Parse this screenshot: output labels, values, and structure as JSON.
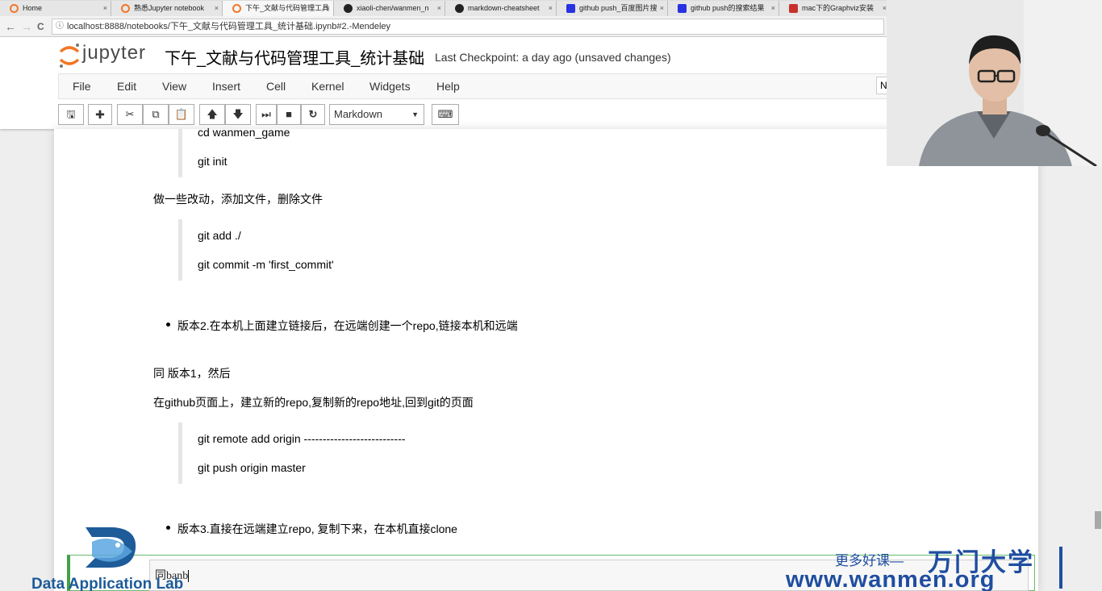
{
  "browser": {
    "tabs": [
      {
        "title": "Home",
        "icon": "jupyter-icon",
        "color": "#f37626"
      },
      {
        "title": "熟悉Jupyter notebook",
        "icon": "jupyter-icon",
        "color": "#f37626"
      },
      {
        "title": "下午_文献与代码管理工具",
        "icon": "jupyter-icon",
        "color": "#f37626",
        "active": true
      },
      {
        "title": "xiaoli-chen/wanmen_n",
        "icon": "github-icon",
        "color": "#222222"
      },
      {
        "title": "markdown-cheatsheet",
        "icon": "github-icon",
        "color": "#222222"
      },
      {
        "title": "github push_百度图片搜",
        "icon": "baidu-icon",
        "color": "#2932e1"
      },
      {
        "title": "github push的搜索结果",
        "icon": "baidu-icon",
        "color": "#2932e1"
      },
      {
        "title": "mac下的Graphviz安装",
        "icon": "csdn-icon",
        "color": "#c9302c"
      }
    ],
    "tab_close": "×",
    "url": "localhost:8888/notebooks/下午_文献与代码管理工具_统计基础.ipynb#2.-Mendeley",
    "back": "←",
    "forward": "→",
    "reload": "C",
    "info": "ⓘ"
  },
  "jupyter": {
    "logo_text": "jupyter",
    "notebook_title": "下午_文献与代码管理工具_统计基础",
    "checkpoint": "Last Checkpoint: a day ago (unsaved changes)",
    "kernel_indicator": "N",
    "menu": [
      "File",
      "Edit",
      "View",
      "Insert",
      "Cell",
      "Kernel",
      "Widgets",
      "Help"
    ],
    "toolbar": {
      "save": "🖫",
      "add": "✚",
      "cut": "✂",
      "copy": "⧉",
      "paste": "📋",
      "up": "🡅",
      "down": "🡇",
      "run": "⏭",
      "stop": "■",
      "restart": "↻",
      "cell_type": "Markdown",
      "caret": "▼",
      "keyboard": "⌨"
    }
  },
  "content": {
    "cmd_cd": "cd wanmen_game",
    "cmd_init": "git init",
    "changes": "做一些改动，添加文件，删除文件",
    "cmd_add": "git add ./",
    "cmd_commit": "git commit -m 'first_commit'",
    "bullet_v2": "版本2.在本机上面建立链接后，在远端创建一个repo,链接本机和远端",
    "same_v1": "同 版本1，然后",
    "github_page": "在github页面上，建立新的repo,复制新的repo地址,回到git的页面",
    "cmd_remote": "git remote add origin ---------------------------",
    "cmd_push": "git push origin master",
    "bullet_v3": "版本3.直接在远端建立repo, 复制下来，在本机直接clone",
    "editing_text": "同banb"
  },
  "watermark": {
    "lab": "Data Application Lab",
    "more": "更多好课—",
    "brand": "万门大学",
    "site": "www.wanmen.org"
  }
}
